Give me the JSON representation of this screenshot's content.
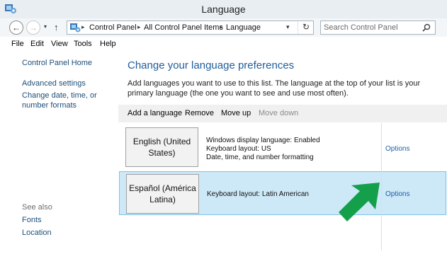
{
  "window": {
    "title": "Language"
  },
  "nav": {
    "back_label": "←",
    "forward_label": "→",
    "recent_label": "▾",
    "up_label": "↑",
    "breadcrumbs": [
      "Control Panel",
      "All Control Panel Items",
      "Language"
    ],
    "separator": "▸",
    "dropdown_label": "▾",
    "refresh_label": "↻",
    "search_placeholder": "Search Control Panel"
  },
  "menu": [
    "File",
    "Edit",
    "View",
    "Tools",
    "Help"
  ],
  "sidebar": {
    "links": [
      "Control Panel Home",
      "Advanced settings",
      "Change date, time, or number formats"
    ],
    "see_also_label": "See also",
    "see_also_links": [
      "Fonts",
      "Location"
    ]
  },
  "main": {
    "title": "Change your language preferences",
    "description": "Add languages you want to use to this list. The language at the top of your list is your primary language (the one you want to see and use most often).",
    "toolbar": [
      "Add a language",
      "Remove",
      "Move up",
      "Move down"
    ],
    "languages": [
      {
        "name": "English (United States)",
        "details": [
          "Windows display language: Enabled",
          "Keyboard layout: US",
          "Date, time, and number formatting"
        ],
        "options_label": "Options"
      },
      {
        "name": "Español (América Latina)",
        "details": [
          "Keyboard layout: Latin American"
        ],
        "options_label": "Options"
      }
    ]
  },
  "colors": {
    "accent": "#1f5d99",
    "selection": "#cde8f7",
    "arrow": "#14a04a"
  }
}
